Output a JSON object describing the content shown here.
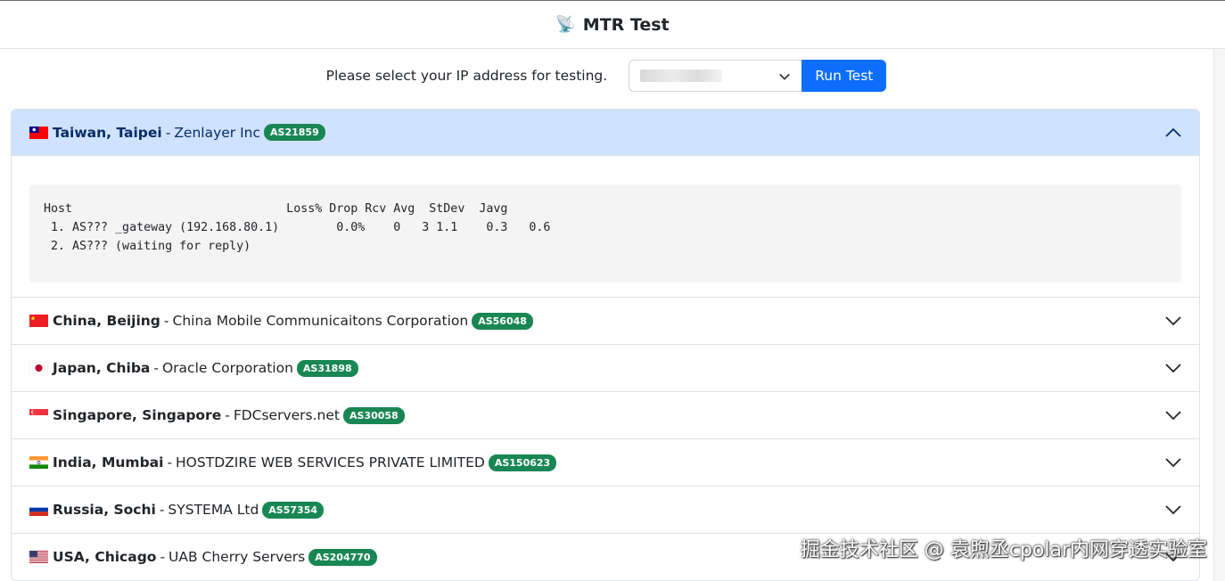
{
  "header": {
    "icon": "satellite-antenna-icon",
    "emoji": "📡",
    "title": "MTR Test"
  },
  "controls": {
    "prompt": "Please select your IP address for testing.",
    "select_value": "",
    "run_label": "Run Test"
  },
  "colors": {
    "primary": "#0d6efd",
    "badge": "#198754",
    "open_header_bg": "#cfe2ff"
  },
  "items": [
    {
      "flag": "flag-taiwan-icon",
      "location": "Taiwan, Taipei",
      "provider": "Zenlayer Inc",
      "asn": "AS21859",
      "expanded": true,
      "output": "Host                              Loss% Drop Rcv Avg  StDev  Javg\n 1. AS??? _gateway (192.168.80.1)        0.0%    0   3 1.1    0.3   0.6\n 2. AS??? (waiting for reply)"
    },
    {
      "flag": "flag-china-icon",
      "location": "China, Beijing",
      "provider": "China Mobile Communicaitons Corporation",
      "asn": "AS56048",
      "expanded": false
    },
    {
      "flag": "flag-japan-icon",
      "location": "Japan, Chiba",
      "provider": "Oracle Corporation",
      "asn": "AS31898",
      "expanded": false
    },
    {
      "flag": "flag-singapore-icon",
      "location": "Singapore, Singapore",
      "provider": "FDCservers.net",
      "asn": "AS30058",
      "expanded": false
    },
    {
      "flag": "flag-india-icon",
      "location": "India, Mumbai",
      "provider": "HOSTDZIRE WEB SERVICES PRIVATE LIMITED",
      "asn": "AS150623",
      "expanded": false
    },
    {
      "flag": "flag-russia-icon",
      "location": "Russia, Sochi",
      "provider": "SYSTEMA Ltd",
      "asn": "AS57354",
      "expanded": false
    },
    {
      "flag": "flag-usa-icon",
      "location": "USA, Chicago",
      "provider": "UAB Cherry Servers",
      "asn": "AS204770",
      "expanded": false
    }
  ],
  "separator": "-",
  "watermark": "掘金技术社区 @ 袁煦丞cpolar内网穿透实验室"
}
